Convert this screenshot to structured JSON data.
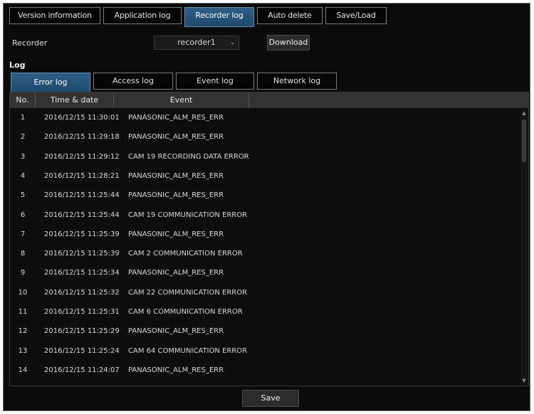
{
  "top_tabs": [
    {
      "label": "Version information"
    },
    {
      "label": "Application log"
    },
    {
      "label": "Recorder log"
    },
    {
      "label": "Auto delete"
    },
    {
      "label": "Save/Load"
    }
  ],
  "recorder": {
    "label": "Recorder",
    "selected": "recorder1"
  },
  "download_label": "Download",
  "log_label": "Log",
  "sub_tabs": [
    {
      "label": "Error log"
    },
    {
      "label": "Access log"
    },
    {
      "label": "Event log"
    },
    {
      "label": "Network log"
    }
  ],
  "table": {
    "headers": {
      "no": "No.",
      "time": "Time & date",
      "event": "Event"
    },
    "rows": [
      {
        "no": "1",
        "time": "2016/12/15 11:30:01",
        "event": "PANASONIC_ALM_RES_ERR"
      },
      {
        "no": "2",
        "time": "2016/12/15 11:29:18",
        "event": "PANASONIC_ALM_RES_ERR"
      },
      {
        "no": "3",
        "time": "2016/12/15 11:29:12",
        "event": "CAM 19 RECORDING DATA ERROR"
      },
      {
        "no": "4",
        "time": "2016/12/15 11:28:21",
        "event": "PANASONIC_ALM_RES_ERR"
      },
      {
        "no": "5",
        "time": "2016/12/15 11:25:44",
        "event": "PANASONIC_ALM_RES_ERR"
      },
      {
        "no": "6",
        "time": "2016/12/15 11:25:44",
        "event": "CAM 19 COMMUNICATION ERROR"
      },
      {
        "no": "7",
        "time": "2016/12/15 11:25:39",
        "event": "PANASONIC_ALM_RES_ERR"
      },
      {
        "no": "8",
        "time": "2016/12/15 11:25:39",
        "event": "CAM 2 COMMUNICATION ERROR"
      },
      {
        "no": "9",
        "time": "2016/12/15 11:25:34",
        "event": "PANASONIC_ALM_RES_ERR"
      },
      {
        "no": "10",
        "time": "2016/12/15 11:25:32",
        "event": "CAM 22 COMMUNICATION ERROR"
      },
      {
        "no": "11",
        "time": "2016/12/15 11:25:31",
        "event": "CAM 6 COMMUNICATION ERROR"
      },
      {
        "no": "12",
        "time": "2016/12/15 11:25:29",
        "event": "PANASONIC_ALM_RES_ERR"
      },
      {
        "no": "13",
        "time": "2016/12/15 11:25:24",
        "event": "CAM 64 COMMUNICATION ERROR"
      },
      {
        "no": "14",
        "time": "2016/12/15 11:24:07",
        "event": "PANASONIC_ALM_RES_ERR"
      }
    ]
  },
  "save_label": "Save"
}
